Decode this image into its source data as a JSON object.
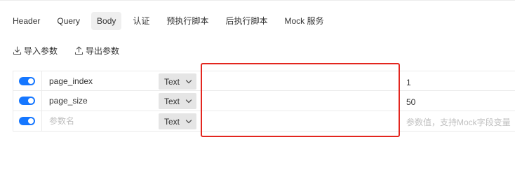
{
  "tabs": [
    {
      "label": "Header",
      "active": false
    },
    {
      "label": "Query",
      "active": false
    },
    {
      "label": "Body",
      "active": true
    },
    {
      "label": "认证",
      "active": false
    },
    {
      "label": "预执行脚本",
      "active": false
    },
    {
      "label": "后执行脚本",
      "active": false
    },
    {
      "label": "Mock 服务",
      "active": false
    }
  ],
  "actions": {
    "import_label": "导入参数",
    "export_label": "导出参数"
  },
  "params": [
    {
      "enabled": true,
      "name": "page_index",
      "type": "Text",
      "value": "1"
    },
    {
      "enabled": true,
      "name": "page_size",
      "type": "Text",
      "value": "50"
    }
  ],
  "new_row": {
    "enabled": true,
    "name_placeholder": "参数名",
    "type": "Text",
    "value_placeholder": "参数值，支持Mock字段变量"
  },
  "colors": {
    "accent": "#1677ff",
    "highlight": "#e3261f"
  }
}
